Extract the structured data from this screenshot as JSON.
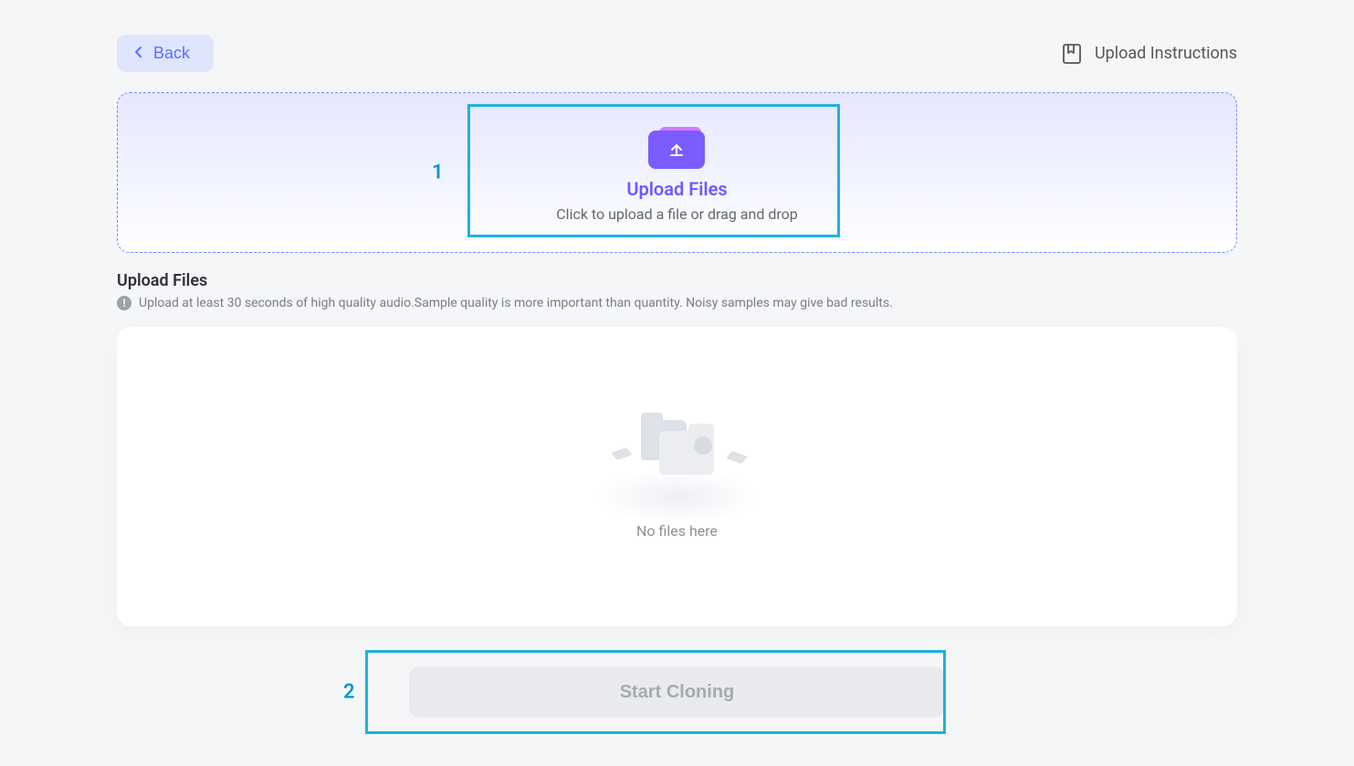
{
  "header": {
    "back_label": "Back",
    "instructions_label": "Upload Instructions"
  },
  "dropzone": {
    "title": "Upload Files",
    "subtitle": "Click to upload a file or drag and drop"
  },
  "section": {
    "title": "Upload Files",
    "hint": "Upload at least 30 seconds of high quality audio.Sample quality is more important than quantity. Noisy samples may give bad results."
  },
  "files": {
    "empty_text": "No files here"
  },
  "actions": {
    "start_label": "Start Cloning"
  },
  "annotations": {
    "step1": "1",
    "step2": "2"
  }
}
